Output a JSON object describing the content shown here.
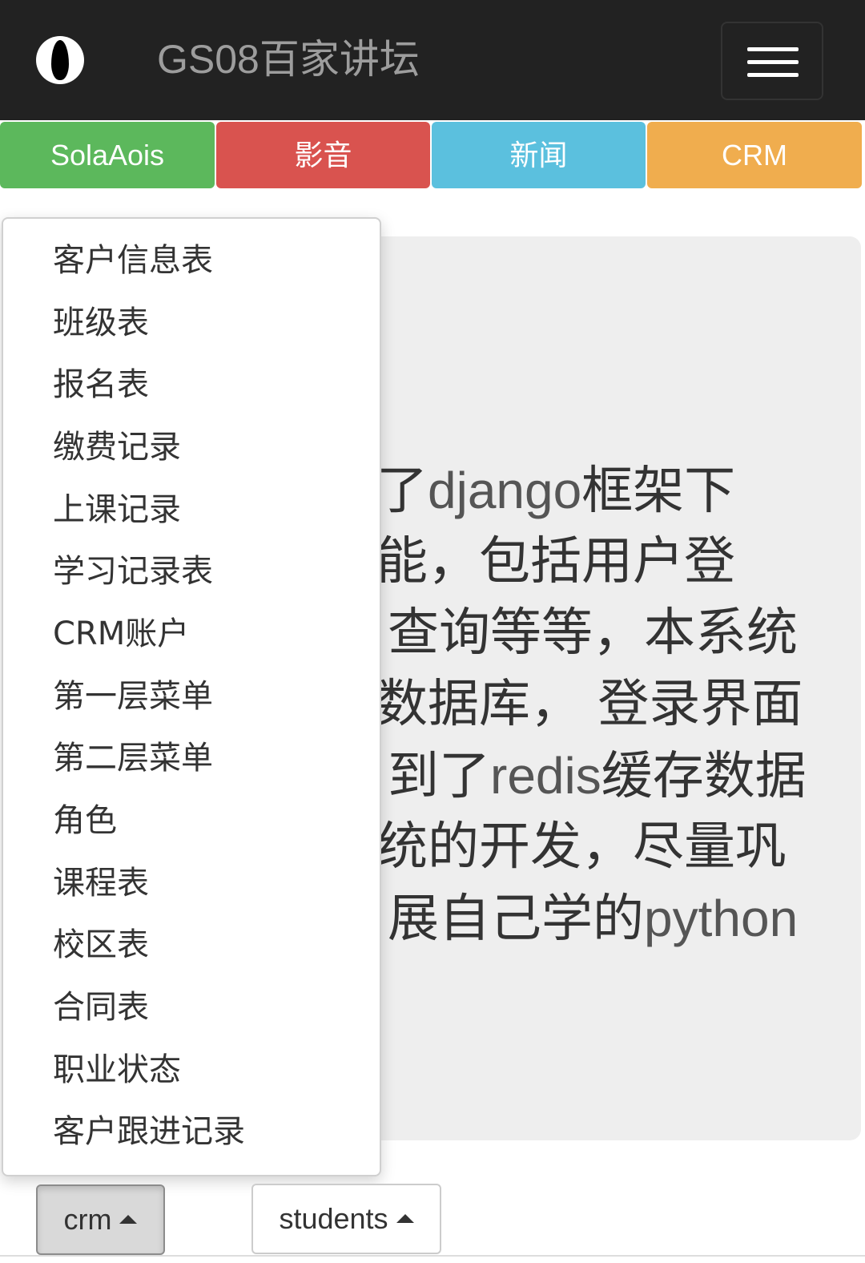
{
  "navbar": {
    "brand": "GS08百家讲坛",
    "logo_icon": "black-drop-logo-icon",
    "toggle_icon": "hamburger-menu-icon",
    "background": "#222222"
  },
  "tabs": [
    {
      "label": "SolaAois",
      "color": "#5cb85c"
    },
    {
      "label": "影音",
      "color": "#d9534f"
    },
    {
      "label": "新闻",
      "color": "#5bc0de"
    },
    {
      "label": "CRM",
      "color": "#f0ad4e"
    }
  ],
  "jumbotron": {
    "lines": [
      {
        "parts": [
          "了",
          "django",
          "框架下"
        ]
      },
      {
        "parts": [
          "能，包括用户登",
          "",
          ""
        ]
      },
      {
        "parts": [
          "查询等等，本系统",
          "",
          ""
        ]
      },
      {
        "parts": [
          "数据库， 登录界面",
          "",
          ""
        ]
      },
      {
        "parts": [
          "到了",
          "redis",
          "缓存数据"
        ]
      },
      {
        "parts": [
          "统的开发，尽量巩",
          "",
          ""
        ]
      },
      {
        "parts": [
          "展自己学的",
          "python",
          ""
        ]
      }
    ]
  },
  "dropdown": {
    "items": [
      "客户信息表",
      "班级表",
      "报名表",
      "缴费记录",
      "上课记录",
      "学习记录表",
      "CRM账户",
      "第一层菜单",
      "第二层菜单",
      "角色",
      "课程表",
      "校区表",
      "合同表",
      "职业状态",
      "客户跟进记录"
    ]
  },
  "bottom_buttons": {
    "crm_label": "crm",
    "students_label": "students",
    "caret_icon": "caret-up-icon"
  }
}
